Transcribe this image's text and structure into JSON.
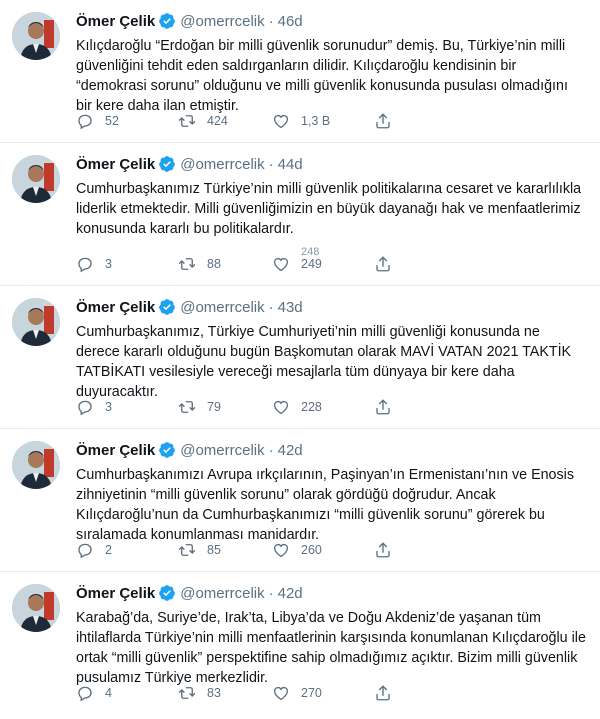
{
  "tweets": [
    {
      "name": "Ömer Çelik",
      "handle": "@omerrcelik",
      "time": "46d",
      "text": "Kılıçdaroğlu “Erdoğan bir milli güvenlik sorunudur” demiş. Bu, Türkiye’nin milli güvenliğini tehdit eden saldırganların dilidir. Kılıçdaroğlu kendisinin bir “demokrasi sorunu” olduğunu ve milli güvenlik konusunda pusulası olmadığını bir kere daha ilan etmiştir.",
      "replies": "52",
      "retweets": "424",
      "likes": "1,3 B",
      "likes_prev": ""
    },
    {
      "name": "Ömer Çelik",
      "handle": "@omerrcelik",
      "time": "44d",
      "text": "Cumhurbaşkanımız Türkiye’nin milli güvenlik politikalarına cesaret ve kararlılıkla liderlik etmektedir. Milli güvenliğimizin en büyük dayanağı hak ve menfaatlerimiz konusunda kararlı bu politikalardır.",
      "replies": "3",
      "retweets": "88",
      "likes": "249",
      "likes_prev": "248"
    },
    {
      "name": "Ömer Çelik",
      "handle": "@omerrcelik",
      "time": "43d",
      "text": "Cumhurbaşkanımız, Türkiye Cumhuriyeti’nin milli güvenliği konusunda ne derece kararlı olduğunu bugün Başkomutan olarak MAVİ VATAN 2021 TAKTİK TATBİKATI vesilesiyle vereceği mesajlarla tüm dünyaya bir kere daha duyuracaktır.",
      "replies": "3",
      "retweets": "79",
      "likes": "228",
      "likes_prev": ""
    },
    {
      "name": "Ömer Çelik",
      "handle": "@omerrcelik",
      "time": "42d",
      "text": "Cumhurbaşkanımızı Avrupa ırkçılarının, Paşinyan’ın Ermenistanı’nın ve Enosis zihniyetinin “milli güvenlik sorunu” olarak gördüğü doğrudur. Ancak Kılıçdaroğlu’nun da Cumhurbaşkanımızı “milli güvenlik sorunu” görerek bu sıralamada konumlanması manidardır.",
      "replies": "2",
      "retweets": "85",
      "likes": "260",
      "likes_prev": ""
    },
    {
      "name": "Ömer Çelik",
      "handle": "@omerrcelik",
      "time": "42d",
      "text": "Karabağ’da, Suriye’de, Irak’ta, Libya’da ve Doğu Akdeniz’de yaşanan tüm ihtilaflarda Türkiye’nin milli menfaatlerinin karşısında konumlanan Kılıçdaroğlu ile ortak “milli güvenlik” perspektifine sahip olmadığımız açıktır. Bizim milli güvenlik pusulamız Türkiye merkezlidir.",
      "replies": "4",
      "retweets": "83",
      "likes": "270",
      "likes_prev": ""
    }
  ],
  "icons": {
    "verified": "verified-badge-icon",
    "reply": "reply-icon",
    "retweet": "retweet-icon",
    "like": "like-icon",
    "share": "share-icon"
  },
  "colors": {
    "text": "#0f1419",
    "secondary": "#5b7083",
    "verified": "#1da1f2",
    "divider": "#e6ecf0"
  }
}
